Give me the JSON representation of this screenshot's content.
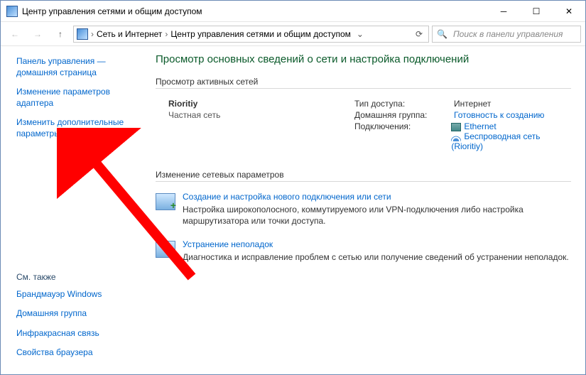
{
  "window": {
    "title": "Центр управления сетями и общим доступом"
  },
  "breadcrumb": {
    "level1": "Сеть и Интернет",
    "level2": "Центр управления сетями и общим доступом"
  },
  "search": {
    "placeholder": "Поиск в панели управления"
  },
  "sidebar": {
    "home": "Панель управления — домашняя страница",
    "adapter": "Изменение параметров адаптера",
    "advanced": "Изменить дополнительные параметры общего доступа",
    "seeAlsoHeading": "См. также",
    "firewall": "Брандмауэр Windows",
    "homegroup": "Домашняя группа",
    "infrared": "Инфракрасная связь",
    "inetoptions": "Свойства браузера"
  },
  "main": {
    "heading": "Просмотр основных сведений о сети и настройка подключений",
    "activeNetworks": "Просмотр активных сетей",
    "network": {
      "name": "Rioritiy",
      "type": "Частная сеть",
      "accessTypeLabel": "Тип доступа:",
      "accessTypeValue": "Интернет",
      "homegroupLabel": "Домашняя группа:",
      "homegroupValue": "Готовность к созданию",
      "connectionsLabel": "Подключения:",
      "ethernet": "Ethernet",
      "wifi": "Беспроводная сеть (Rioritiy)"
    },
    "changeSettings": "Изменение сетевых параметров",
    "actions": {
      "setup": {
        "title": "Создание и настройка нового подключения или сети",
        "desc": "Настройка широкополосного, коммутируемого или VPN-подключения либо настройка маршрутизатора или точки доступа."
      },
      "troubleshoot": {
        "title": "Устранение неполадок",
        "desc": "Диагностика и исправление проблем с сетью или получение сведений об устранении неполадок."
      }
    }
  }
}
